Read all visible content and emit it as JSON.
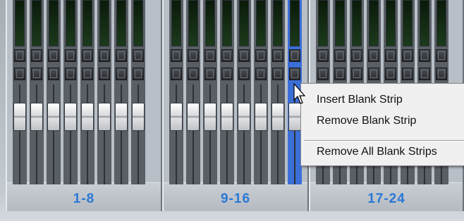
{
  "banks": [
    {
      "label": "1-8"
    },
    {
      "label": "9-16"
    },
    {
      "label": "17-24"
    }
  ],
  "context_menu": {
    "items": [
      {
        "label": "Insert Blank Strip"
      },
      {
        "label": "Remove Blank Strip"
      },
      {
        "label": "Remove All Blank Strips"
      }
    ]
  },
  "colors": {
    "bank_label": "#2a78d6",
    "selected_strip": "#3b6fd8",
    "meter_green": "#1c3a1c"
  },
  "icons": {
    "cursor": "arrow-cursor-icon"
  }
}
